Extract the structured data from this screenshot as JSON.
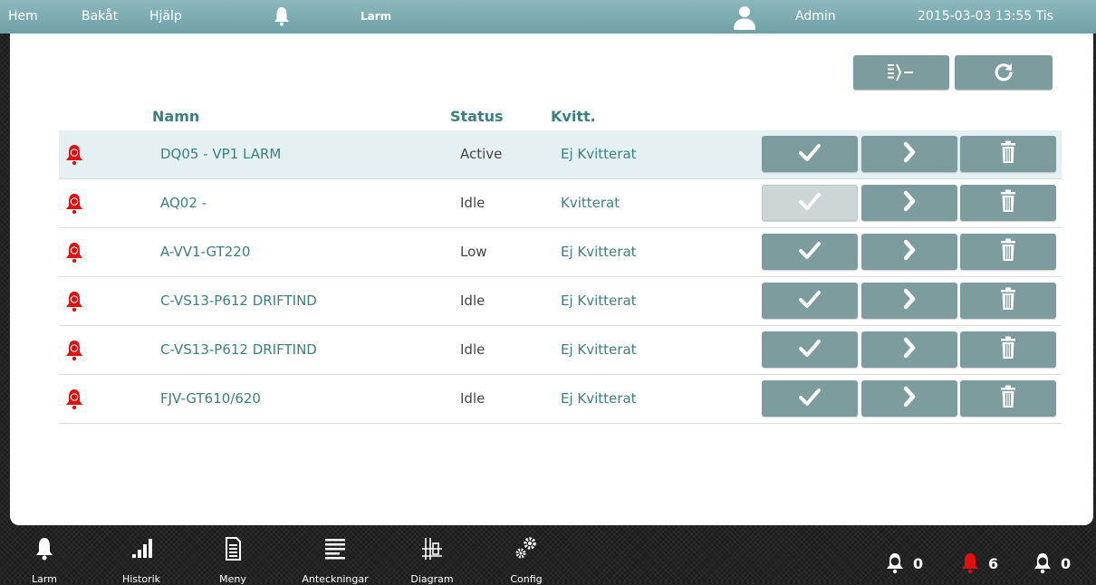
{
  "topbar": {
    "home_label": "Hem",
    "back_label": "Bakåt",
    "help_label": "Hjälp",
    "section_title": "Larm",
    "user_label": "Admin",
    "datetime": "2015-03-03 13:55 Tis",
    "icons": [
      "bell-icon",
      "user-icon"
    ]
  },
  "table": {
    "headers": {
      "name": "Namn",
      "status": "Status",
      "ack": "Kvitt."
    },
    "rows": [
      {
        "priority": "B",
        "name": "DQ05 - VP1 LARM",
        "status": "Active",
        "ack": "Ej Kvitterat",
        "acknowledged": false,
        "selected": true
      },
      {
        "priority": "B",
        "name": "AQ02 -",
        "status": "Idle",
        "ack": "Kvitterat",
        "acknowledged": true,
        "selected": false
      },
      {
        "priority": "B",
        "name": "A-VV1-GT220",
        "status": "Low",
        "ack": "Ej Kvitterat",
        "acknowledged": false,
        "selected": false
      },
      {
        "priority": "B",
        "name": "C-VS13-P612 DRIFTIND",
        "status": "Idle",
        "ack": "Ej Kvitterat",
        "acknowledged": false,
        "selected": false
      },
      {
        "priority": "B",
        "name": "C-VS13-P612 DRIFTIND",
        "status": "Idle",
        "ack": "Ej Kvitterat",
        "acknowledged": false,
        "selected": false
      },
      {
        "priority": "B",
        "name": "FJV-GT610/620",
        "status": "Idle",
        "ack": "Ej Kvitterat",
        "acknowledged": false,
        "selected": false
      }
    ]
  },
  "toolbar": {
    "icons": [
      "filter-icon",
      "refresh-icon"
    ]
  },
  "row_actions": {
    "icons": [
      "check-icon",
      "chevron-right-icon",
      "trash-icon"
    ]
  },
  "bottombar": {
    "nav": [
      {
        "label": "Larm",
        "icon": "bell-icon"
      },
      {
        "label": "Historik",
        "icon": "bar-chart-icon"
      },
      {
        "label": "Meny",
        "icon": "document-icon"
      },
      {
        "label": "Anteckningar",
        "icon": "notes-icon"
      },
      {
        "label": "Diagram",
        "icon": "diagram-icon"
      },
      {
        "label": "Config",
        "icon": "gears-icon"
      }
    ],
    "counters": [
      {
        "class": "A",
        "count": "0"
      },
      {
        "class": "B",
        "count": "6"
      },
      {
        "class": "C",
        "count": "0"
      }
    ]
  },
  "colors": {
    "topbar": "#7fadb1",
    "accent_text": "#3d7f7c",
    "button": "#7c9c9e",
    "selected_row": "#e4f0f1",
    "alarm_red": "#e01010"
  }
}
